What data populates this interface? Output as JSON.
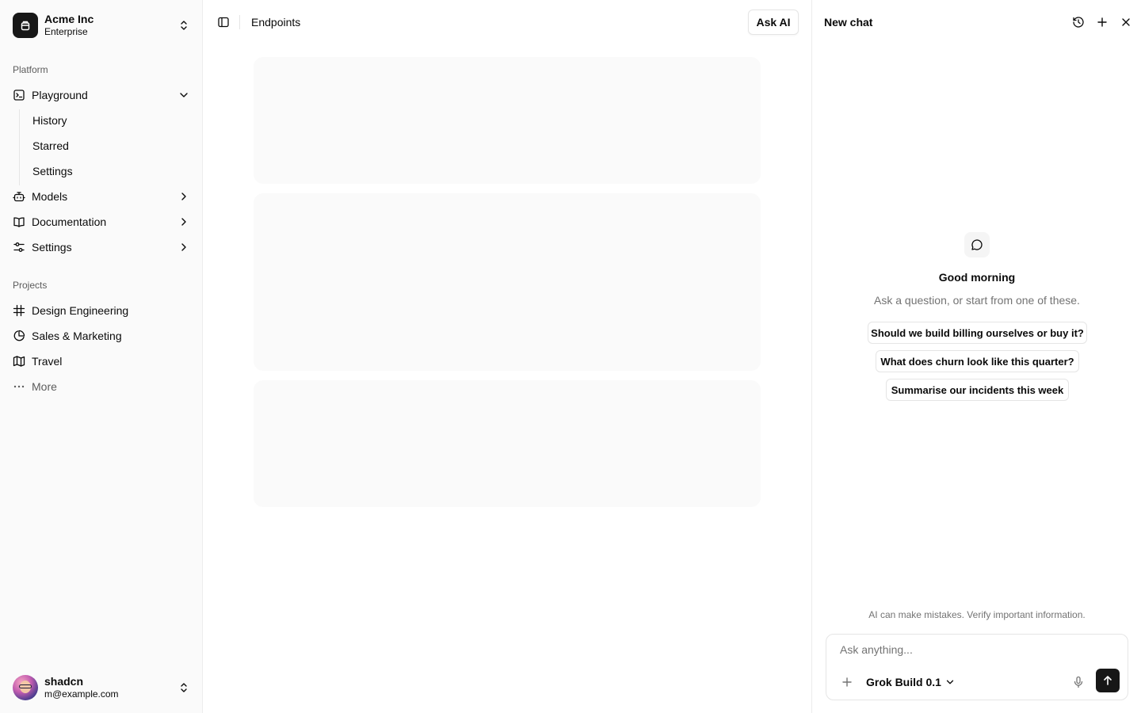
{
  "org": {
    "name": "Acme Inc",
    "plan": "Enterprise"
  },
  "sidebar": {
    "platform_label": "Platform",
    "nav": [
      {
        "label": "Playground",
        "icon": "terminal-square-icon",
        "expanded": true
      },
      {
        "label": "Models",
        "icon": "bot-icon",
        "expanded": false
      },
      {
        "label": "Documentation",
        "icon": "book-open-icon",
        "expanded": false
      },
      {
        "label": "Settings",
        "icon": "settings-sliders-icon",
        "expanded": false
      }
    ],
    "playground_sub": [
      "History",
      "Starred",
      "Settings"
    ],
    "projects_label": "Projects",
    "projects": [
      {
        "label": "Design Engineering",
        "icon": "frame-icon"
      },
      {
        "label": "Sales & Marketing",
        "icon": "pie-chart-icon"
      },
      {
        "label": "Travel",
        "icon": "map-icon"
      }
    ],
    "more_label": "More"
  },
  "user": {
    "name": "shadcn",
    "email": "m@example.com"
  },
  "main": {
    "breadcrumb": "Endpoints",
    "ask_ai_label": "Ask AI"
  },
  "chat": {
    "title": "New chat",
    "greeting": "Good morning",
    "subtitle": "Ask a question, or start from one of these.",
    "suggestions": [
      "Should we build billing ourselves or buy it?",
      "What does churn look like this quarter?",
      "Summarise our incidents this week"
    ],
    "disclaimer": "AI can make mistakes. Verify important information.",
    "input_placeholder": "Ask anything...",
    "model_label": "Grok Build 0.1"
  },
  "colors": {
    "accent_dark": "#171717",
    "muted_text": "#737373",
    "border": "#e5e5e5",
    "sidebar_bg": "#fafafa"
  }
}
